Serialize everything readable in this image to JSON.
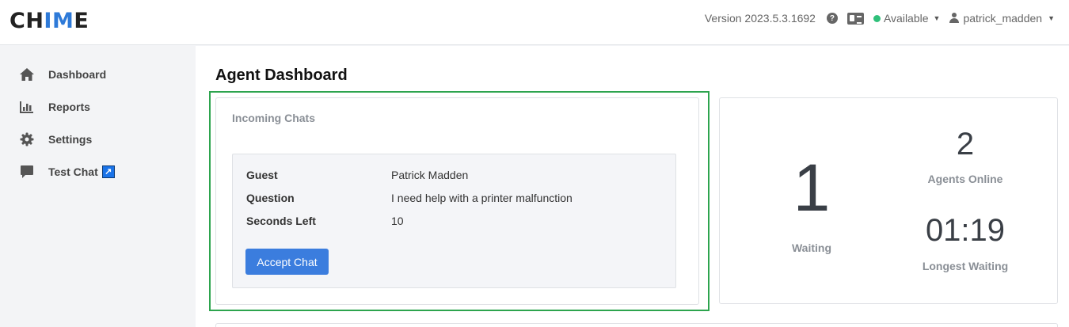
{
  "header": {
    "logo_prefix": "CH",
    "logo_accent": "IM",
    "logo_suffix": "E",
    "version": "Version 2023.5.3.1692",
    "status": "Available",
    "username": "patrick_madden"
  },
  "sidebar": {
    "items": [
      {
        "label": "Dashboard",
        "icon": "home-icon"
      },
      {
        "label": "Reports",
        "icon": "bar-chart-icon"
      },
      {
        "label": "Settings",
        "icon": "gear-icon"
      },
      {
        "label": "Test Chat",
        "icon": "chat-bubble-icon"
      }
    ]
  },
  "main": {
    "title": "Agent Dashboard",
    "incoming": {
      "title": "Incoming Chats",
      "rows": [
        {
          "label": "Guest",
          "value": "Patrick Madden"
        },
        {
          "label": "Question",
          "value": "I need help with a printer malfunction"
        },
        {
          "label": "Seconds Left",
          "value": "10"
        }
      ],
      "accept_label": "Accept Chat"
    },
    "stats": {
      "waiting_count": "1",
      "waiting_label": "Waiting",
      "agents_count": "2",
      "agents_label": "Agents Online",
      "longest_time": "01:19",
      "longest_label": "Longest Waiting"
    }
  },
  "colors": {
    "accent": "#3b7dde",
    "highlight": "#2da44e",
    "status_available": "#2fc07a"
  }
}
